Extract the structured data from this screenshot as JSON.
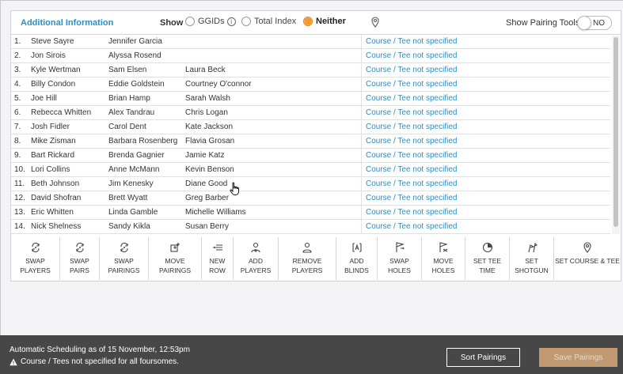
{
  "header": {
    "title": "Additional Information",
    "show_label": "Show",
    "options": [
      {
        "label": "GGIDs",
        "selected": false
      },
      {
        "label": "Total Index",
        "selected": false
      },
      {
        "label": "Neither",
        "selected": true
      }
    ],
    "pairing_tools_label": "Show Pairing Tools",
    "pairing_tools_toggle": "NO"
  },
  "rows": [
    {
      "num": "1.",
      "p1": "Steve Sayre",
      "p2": "Jennifer Garcia",
      "p3": "",
      "course": "Course / Tee not specified"
    },
    {
      "num": "2.",
      "p1": "Jon Sirois",
      "p2": "Alyssa Rosend",
      "p3": "",
      "course": "Course / Tee not specified"
    },
    {
      "num": "3.",
      "p1": "Kyle Wertman",
      "p2": "Sam Elsen",
      "p3": "Laura Beck",
      "course": "Course / Tee not specified"
    },
    {
      "num": "4.",
      "p1": "Billy Condon",
      "p2": "Eddie Goldstein",
      "p3": "Courtney O'connor",
      "course": "Course / Tee not specified"
    },
    {
      "num": "5.",
      "p1": "Joe Hill",
      "p2": "Brian Hamp",
      "p3": "Sarah Walsh",
      "course": "Course / Tee not specified"
    },
    {
      "num": "6.",
      "p1": "Rebecca Whitten",
      "p2": "Alex Tandrau",
      "p3": "Chris Logan",
      "course": "Course / Tee not specified"
    },
    {
      "num": "7.",
      "p1": "Josh Fidler",
      "p2": "Carol Dent",
      "p3": "Kate Jackson",
      "course": "Course / Tee not specified"
    },
    {
      "num": "8.",
      "p1": "Mike Zisman",
      "p2": "Barbara Rosenberg",
      "p3": "Flavia Grosan",
      "course": "Course / Tee not specified"
    },
    {
      "num": "9.",
      "p1": "Bart Rickard",
      "p2": "Brenda Gagnier",
      "p3": "Jamie Katz",
      "course": "Course / Tee not specified"
    },
    {
      "num": "10.",
      "p1": "Lori Collins",
      "p2": "Anne McMann",
      "p3": "Kevin Benson",
      "course": "Course / Tee not specified"
    },
    {
      "num": "11.",
      "p1": "Beth Johnson",
      "p2": "Jim Kenesky",
      "p3": "Diane Good",
      "course": "Course / Tee not specified"
    },
    {
      "num": "12.",
      "p1": "David Shofran",
      "p2": "Brett Wyatt",
      "p3": "Greg Barber",
      "course": "Course / Tee not specified"
    },
    {
      "num": "13.",
      "p1": "Eric Whitten",
      "p2": "Linda Gamble",
      "p3": "Michelle Williams",
      "course": "Course / Tee not specified"
    },
    {
      "num": "14.",
      "p1": "Nick Shelness",
      "p2": "Sandy Kikla",
      "p3": "Susan Berry",
      "course": "Course / Tee not specified"
    }
  ],
  "toolbar": [
    {
      "label": "SWAP\nPLAYERS",
      "icon": "swap-icon"
    },
    {
      "label": "SWAP\nPAIRS",
      "icon": "swap-icon"
    },
    {
      "label": "SWAP\nPAIRINGS",
      "icon": "swap-icon"
    },
    {
      "label": "MOVE\nPAIRINGS",
      "icon": "move-icon"
    },
    {
      "label": "NEW\nROW",
      "icon": "new-row-icon"
    },
    {
      "label": "ADD\nPLAYERS",
      "icon": "add-user-icon"
    },
    {
      "label": "REMOVE\nPLAYERS",
      "icon": "remove-user-icon"
    },
    {
      "label": "ADD\nBLINDS",
      "icon": "blind-icon"
    },
    {
      "label": "SWAP\nHOLES",
      "icon": "flag-icon"
    },
    {
      "label": "MOVE\nHOLES",
      "icon": "flag-move-icon"
    },
    {
      "label": "SET TEE\nTIME",
      "icon": "clock-icon"
    },
    {
      "label": "SET\nSHOTGUN",
      "icon": "shotgun-icon"
    },
    {
      "label": "SET COURSE & TEE",
      "icon": "pin-icon"
    }
  ],
  "footer": {
    "scheduling": "Automatic Scheduling as of 15 November, 12:53pm",
    "warning": "Course / Tees not specified for all foursomes.",
    "sort_button": "Sort Pairings",
    "save_button": "Save Pairings"
  }
}
